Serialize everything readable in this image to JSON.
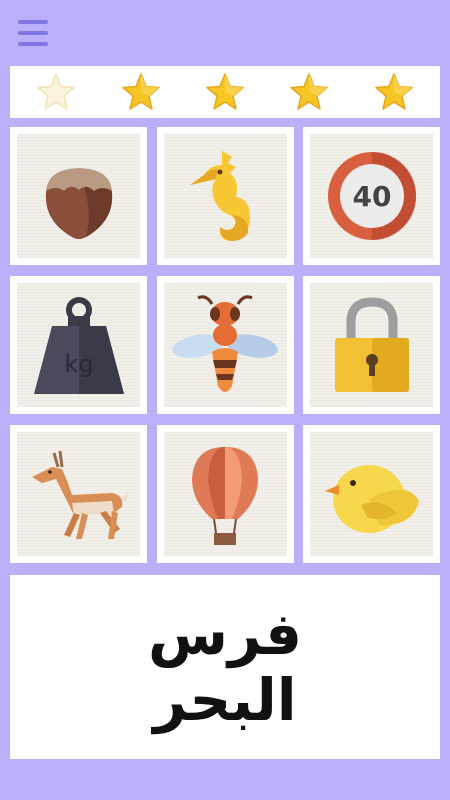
{
  "header": {
    "menu_icon": "hamburger-menu-icon"
  },
  "rating": {
    "stars": [
      {
        "state": "empty"
      },
      {
        "state": "filled"
      },
      {
        "state": "filled"
      },
      {
        "state": "filled"
      },
      {
        "state": "filled"
      }
    ],
    "colors": {
      "filled": "#f7c624",
      "empty": "#f9f1d6"
    }
  },
  "cards": [
    {
      "icon": "hazelnut-icon"
    },
    {
      "icon": "seahorse-icon"
    },
    {
      "icon": "speed-limit-sign-icon",
      "sign_text": "40"
    },
    {
      "icon": "kg-weight-icon",
      "weight_text": "kg"
    },
    {
      "icon": "bee-icon"
    },
    {
      "icon": "padlock-icon"
    },
    {
      "icon": "antelope-icon"
    },
    {
      "icon": "hot-air-balloon-icon"
    },
    {
      "icon": "chick-icon"
    }
  ],
  "answer": {
    "line1": "فرس",
    "line2": "البحر"
  },
  "colors": {
    "background": "#b9b0f9",
    "accent": "#8076e4"
  }
}
